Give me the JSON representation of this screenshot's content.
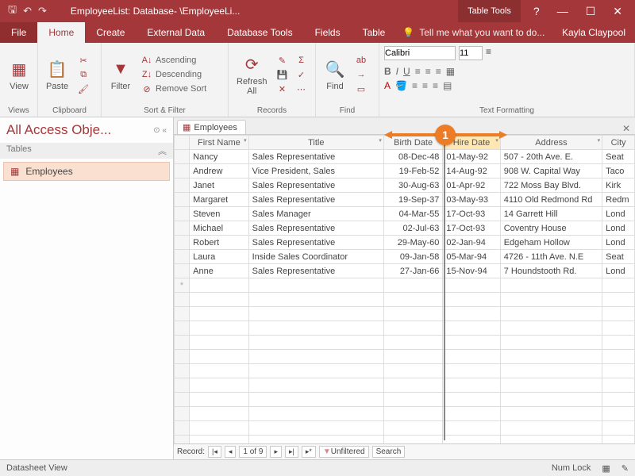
{
  "window": {
    "title": "EmployeeList: Database- \\EmployeeLi...",
    "context_tab": "Table Tools",
    "user": "Kayla Claypool"
  },
  "tabs": {
    "file": "File",
    "home": "Home",
    "create": "Create",
    "external": "External Data",
    "dbtools": "Database Tools",
    "fields": "Fields",
    "table": "Table",
    "tell": "Tell me what you want to do..."
  },
  "ribbon": {
    "views": {
      "label": "Views",
      "view": "View"
    },
    "clipboard": {
      "label": "Clipboard",
      "paste": "Paste"
    },
    "sortfilter": {
      "label": "Sort & Filter",
      "filter": "Filter",
      "asc": "Ascending",
      "desc": "Descending",
      "remove": "Remove Sort"
    },
    "records": {
      "label": "Records",
      "refresh": "Refresh\nAll"
    },
    "find": {
      "label": "Find",
      "find": "Find"
    },
    "text": {
      "label": "Text Formatting",
      "font": "Calibri",
      "size": "11"
    }
  },
  "nav": {
    "header": "All Access Obje...",
    "section": "Tables",
    "item": "Employees"
  },
  "tab": {
    "name": "Employees"
  },
  "columns": {
    "fn": "First Name",
    "title": "Title",
    "bd": "Birth Date",
    "hd": "Hire Date",
    "addr": "Address",
    "city": "City"
  },
  "rows": [
    {
      "fn": "Nancy",
      "title": "Sales Representative",
      "bd": "08-Dec-48",
      "hd": "01-May-92",
      "addr": "507 - 20th Ave. E.",
      "city": "Seattle"
    },
    {
      "fn": "Andrew",
      "title": "Vice President, Sales",
      "bd": "19-Feb-52",
      "hd": "14-Aug-92",
      "addr": "908 W. Capital Way",
      "city": "Tacoma"
    },
    {
      "fn": "Janet",
      "title": "Sales Representative",
      "bd": "30-Aug-63",
      "hd": "01-Apr-92",
      "addr": "722 Moss Bay Blvd.",
      "city": "Kirkland"
    },
    {
      "fn": "Margaret",
      "title": "Sales Representative",
      "bd": "19-Sep-37",
      "hd": "03-May-93",
      "addr": "4110 Old Redmond Rd",
      "city": "Redmond"
    },
    {
      "fn": "Steven",
      "title": "Sales Manager",
      "bd": "04-Mar-55",
      "hd": "17-Oct-93",
      "addr": "14 Garrett Hill",
      "city": "London"
    },
    {
      "fn": "Michael",
      "title": "Sales Representative",
      "bd": "02-Jul-63",
      "hd": "17-Oct-93",
      "addr": "Coventry House",
      "city": "London"
    },
    {
      "fn": "Robert",
      "title": "Sales Representative",
      "bd": "29-May-60",
      "hd": "02-Jan-94",
      "addr": "Edgeham Hollow",
      "city": "London"
    },
    {
      "fn": "Laura",
      "title": "Inside Sales Coordinator",
      "bd": "09-Jan-58",
      "hd": "05-Mar-94",
      "addr": "4726 - 11th Ave. N.E",
      "city": "Seattle"
    },
    {
      "fn": "Anne",
      "title": "Sales Representative",
      "bd": "27-Jan-66",
      "hd": "15-Nov-94",
      "addr": "7 Houndstooth Rd.",
      "city": "London"
    }
  ],
  "recnav": {
    "label": "Record:",
    "pos": "1 of 9",
    "filter": "Unfiltered",
    "search": "Search"
  },
  "status": {
    "view": "Datasheet View",
    "numlock": "Num Lock"
  },
  "callout": {
    "num": "1"
  }
}
